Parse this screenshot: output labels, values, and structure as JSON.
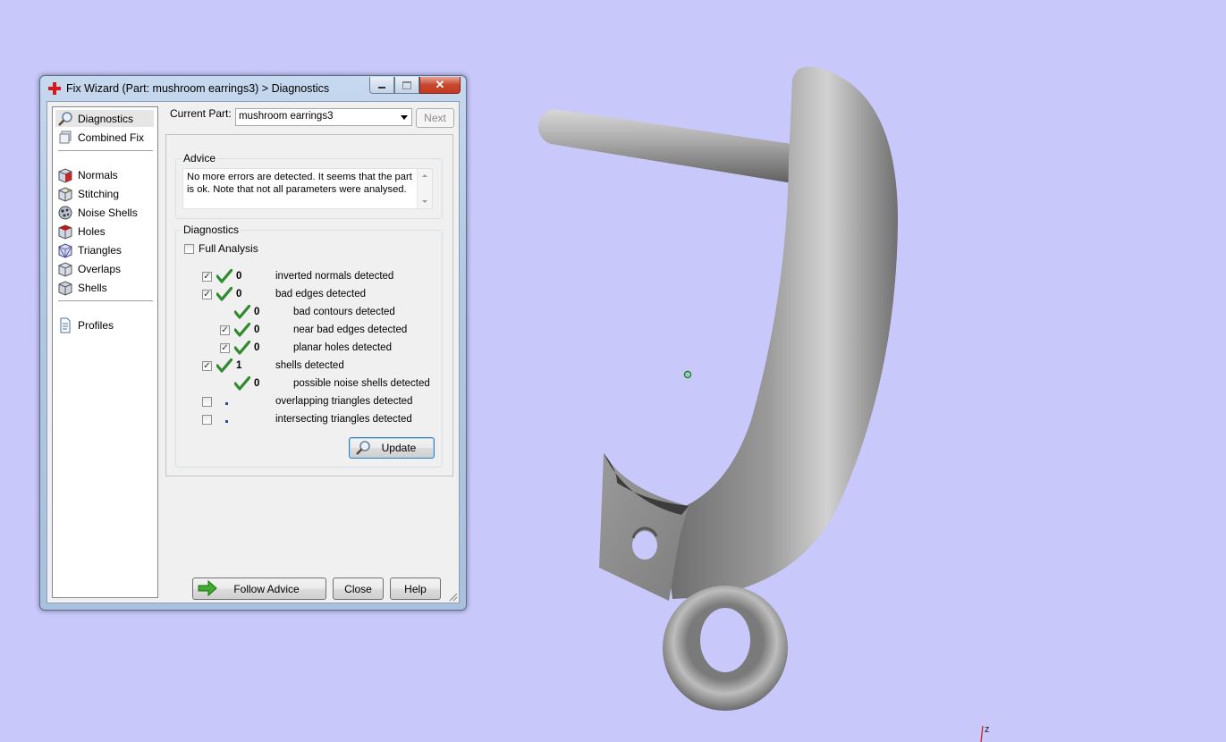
{
  "window": {
    "title": "Fix Wizard (Part: mushroom earrings3) > Diagnostics",
    "close_glyph": "✕"
  },
  "sidebar": {
    "items": [
      {
        "label": "Diagnostics",
        "icon": "magnifier-icon",
        "selected": true
      },
      {
        "label": "Combined Fix",
        "icon": "combined-fix-icon"
      },
      {
        "label": "Normals",
        "icon": "normals-cube-icon"
      },
      {
        "label": "Stitching",
        "icon": "stitching-cube-icon"
      },
      {
        "label": "Noise Shells",
        "icon": "noise-shells-icon"
      },
      {
        "label": "Holes",
        "icon": "holes-cube-icon"
      },
      {
        "label": "Triangles",
        "icon": "triangles-cube-icon"
      },
      {
        "label": "Overlaps",
        "icon": "overlaps-cube-icon"
      },
      {
        "label": "Shells",
        "icon": "shells-cube-icon"
      },
      {
        "label": "Profiles",
        "icon": "profiles-document-icon"
      }
    ]
  },
  "current_part": {
    "label": "Current Part:",
    "value": "mushroom earrings3",
    "next_label": "Next"
  },
  "advice": {
    "legend": "Advice",
    "text": "No more errors are detected. It seems that the part is ok. Note that not all parameters were analysed."
  },
  "diagnostics": {
    "legend": "Diagnostics",
    "full_analysis_label": "Full Analysis",
    "full_analysis_checked": false,
    "rows": [
      {
        "checkbox": true,
        "checked": true,
        "status": "ok",
        "count": "0",
        "label": "inverted normals detected",
        "indent": 0
      },
      {
        "checkbox": true,
        "checked": true,
        "status": "ok",
        "count": "0",
        "label": "bad edges detected",
        "indent": 0
      },
      {
        "checkbox": false,
        "checked": false,
        "status": "ok",
        "count": "0",
        "label": "bad contours detected",
        "indent": 1
      },
      {
        "checkbox": true,
        "checked": true,
        "status": "ok",
        "count": "0",
        "label": "near bad edges detected",
        "indent": 1
      },
      {
        "checkbox": true,
        "checked": true,
        "status": "ok",
        "count": "0",
        "label": "planar holes detected",
        "indent": 1
      },
      {
        "checkbox": true,
        "checked": true,
        "status": "ok",
        "count": "1",
        "label": "shells detected",
        "indent": 0
      },
      {
        "checkbox": false,
        "checked": false,
        "status": "ok",
        "count": "0",
        "label": "possible noise shells detected",
        "indent": 1
      },
      {
        "checkbox": true,
        "checked": false,
        "status": "none",
        "count": "",
        "label": "overlapping triangles detected",
        "indent": 0
      },
      {
        "checkbox": true,
        "checked": false,
        "status": "none",
        "count": "",
        "label": "intersecting triangles detected",
        "indent": 0
      }
    ],
    "update_label": "Update"
  },
  "footer": {
    "follow_advice_label": "Follow Advice",
    "close_label": "Close",
    "help_label": "Help"
  },
  "viewport": {
    "axis_label": "z",
    "background": "#c8c8fa",
    "model_color": "#8c8c8c"
  }
}
